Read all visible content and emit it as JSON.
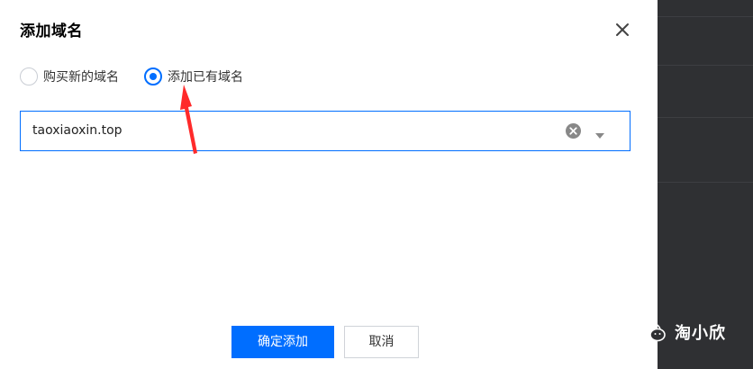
{
  "dialog": {
    "title": "添加域名",
    "close_icon": "close-icon"
  },
  "radio_options": [
    {
      "label": "购买新的域名",
      "checked": false
    },
    {
      "label": "添加已有域名",
      "checked": true
    }
  ],
  "domain_select": {
    "value": "taoxiaoxin.top",
    "clear_icon": "clear-circle-icon",
    "dropdown_icon": "caret-down-icon"
  },
  "buttons": {
    "confirm_label": "确定添加",
    "cancel_label": "取消"
  },
  "watermark": {
    "text": "淘小欣",
    "icon": "wechat-icon"
  },
  "colors": {
    "accent": "#006eff",
    "annotation": "#ff2a2a",
    "dark_panel": "#2f3033"
  }
}
